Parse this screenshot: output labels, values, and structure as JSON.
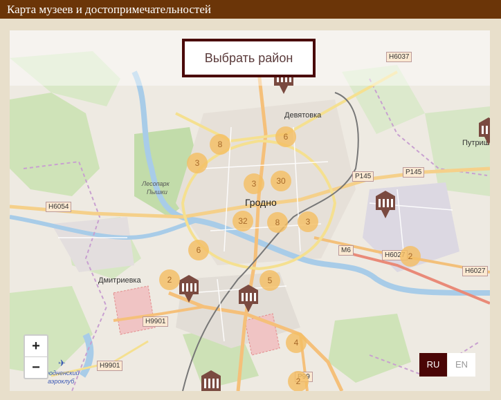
{
  "header": {
    "title": "Карта музеев и достопримечательностей"
  },
  "district_button": "Выбрать район",
  "clusters": [
    {
      "id": "a",
      "count": "8"
    },
    {
      "id": "b",
      "count": "3"
    },
    {
      "id": "c",
      "count": "6"
    },
    {
      "id": "d",
      "count": "3"
    },
    {
      "id": "e",
      "count": "30"
    },
    {
      "id": "f",
      "count": "32"
    },
    {
      "id": "g",
      "count": "8"
    },
    {
      "id": "h",
      "count": "3"
    },
    {
      "id": "i",
      "count": "6"
    },
    {
      "id": "j",
      "count": "2"
    },
    {
      "id": "k",
      "count": "5"
    },
    {
      "id": "l",
      "count": "4"
    },
    {
      "id": "m",
      "count": "2"
    },
    {
      "id": "n",
      "count": "2"
    }
  ],
  "labels": {
    "devyatovka": "Девятовка",
    "grodno": "Гродно",
    "dmitrievka": "Дмитриевка",
    "putrish": "Путриш",
    "lesopark1": "Лесопарк",
    "lesopark2": "Пышки",
    "aeroclub1": "родненский",
    "aeroclub2": "аэроклуб"
  },
  "roads": {
    "h6037": "H6037",
    "h6054": "H6054",
    "p145a": "P145",
    "p145b": "P145",
    "m6": "M6",
    "h6027a": "H6027",
    "h6027b": "H6027",
    "h9901a": "H9901",
    "h9901b": "H9901",
    "p99": "P99"
  },
  "zoom": {
    "in": "+",
    "out": "−"
  },
  "languages": {
    "ru": "RU",
    "en": "EN",
    "active": "RU"
  },
  "colors": {
    "header": "#6b3508",
    "accent": "#4a0606",
    "cluster": "#f4be64",
    "marker": "#7a4a40"
  }
}
